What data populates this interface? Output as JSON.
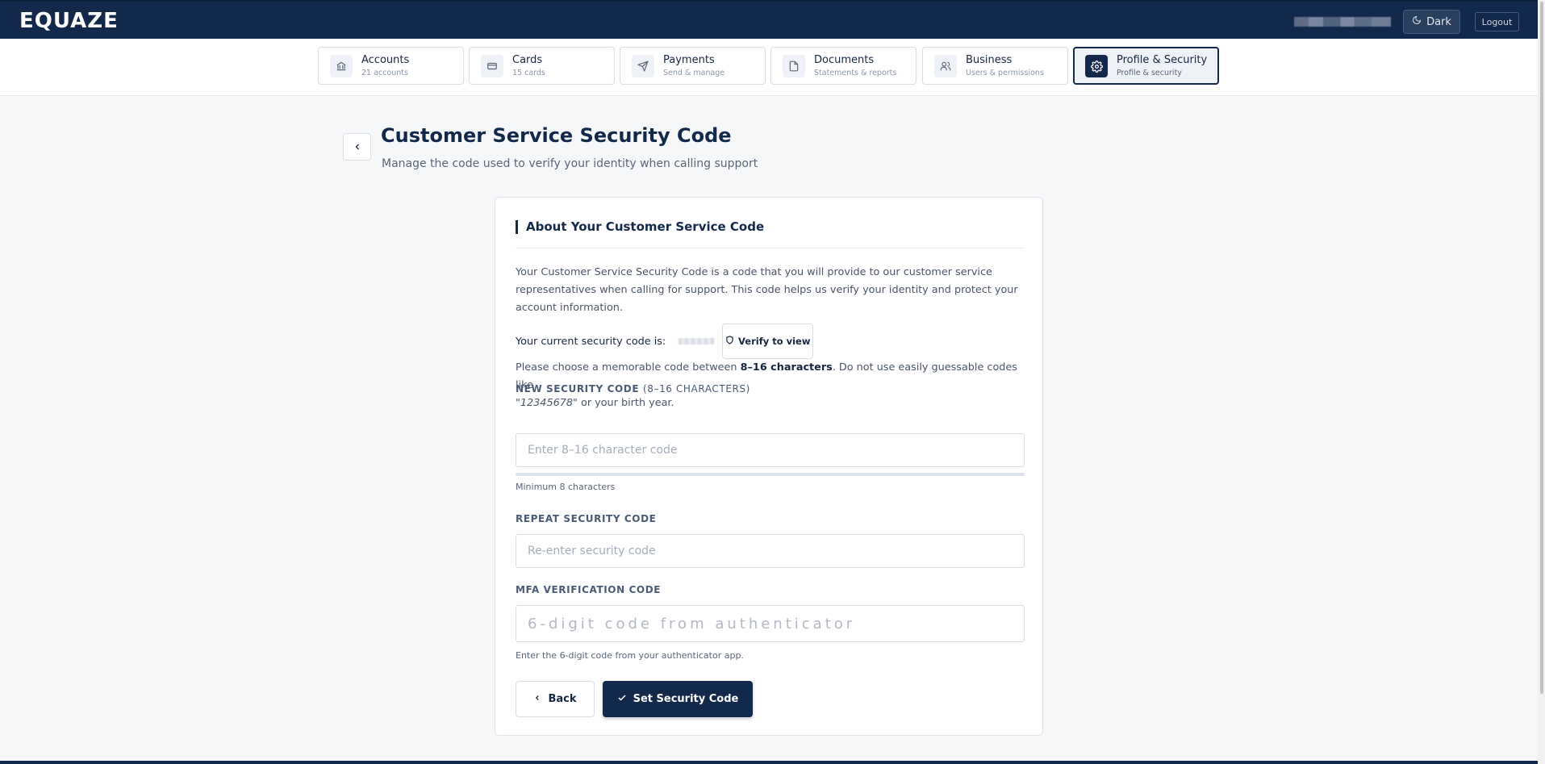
{
  "header": {
    "logo": "EQUAZE",
    "dark_label": "Dark",
    "logout_label": "Logout"
  },
  "nav": {
    "tabs": [
      {
        "title": "Accounts",
        "sub": "21 accounts",
        "icon": "bank-icon"
      },
      {
        "title": "Cards",
        "sub": "15 cards",
        "icon": "card-icon"
      },
      {
        "title": "Payments",
        "sub": "Send & manage",
        "icon": "send-icon"
      },
      {
        "title": "Documents",
        "sub": "Statements & reports",
        "icon": "document-icon"
      },
      {
        "title": "Business",
        "sub": "Users & permissions",
        "icon": "users-icon"
      },
      {
        "title": "Profile & Security",
        "sub": "Profile & security",
        "icon": "gear-icon",
        "active": true
      }
    ]
  },
  "page": {
    "title": "Customer Service Security Code",
    "subtitle": "Manage the code used to verify your identity when calling support"
  },
  "card": {
    "title": "About Your Customer Service Code",
    "intro": "Your Customer Service Security Code is a code that you will provide to our customer service representatives when calling for support. This code helps us verify your identity and protect your account information.",
    "current_label": "Your current security code is:",
    "verify_label": "Verify to view",
    "hint_pre": "Please choose a memorable code between ",
    "hint_bold": "8–16 characters",
    "hint_mid": ". Do not use easily guessable codes like ",
    "hint_example": "\"12345678\"",
    "hint_post": " or your birth year."
  },
  "form": {
    "new_code": {
      "label": "NEW SECURITY CODE",
      "label_suffix": "(8–16 CHARACTERS)",
      "placeholder": "Enter 8–16 character code",
      "value": "",
      "help": "Minimum 8 characters"
    },
    "repeat_code": {
      "label": "REPEAT SECURITY CODE",
      "placeholder": "Re-enter security code",
      "value": ""
    },
    "mfa": {
      "label": "MFA VERIFICATION CODE",
      "placeholder": "6-digit code from authenticator",
      "value": "",
      "help": "Enter the 6-digit code from your authenticator app."
    }
  },
  "actions": {
    "back_label": "Back",
    "submit_label": "Set Security Code"
  },
  "colors": {
    "primary": "#13294b",
    "background": "#f6f7f9"
  }
}
